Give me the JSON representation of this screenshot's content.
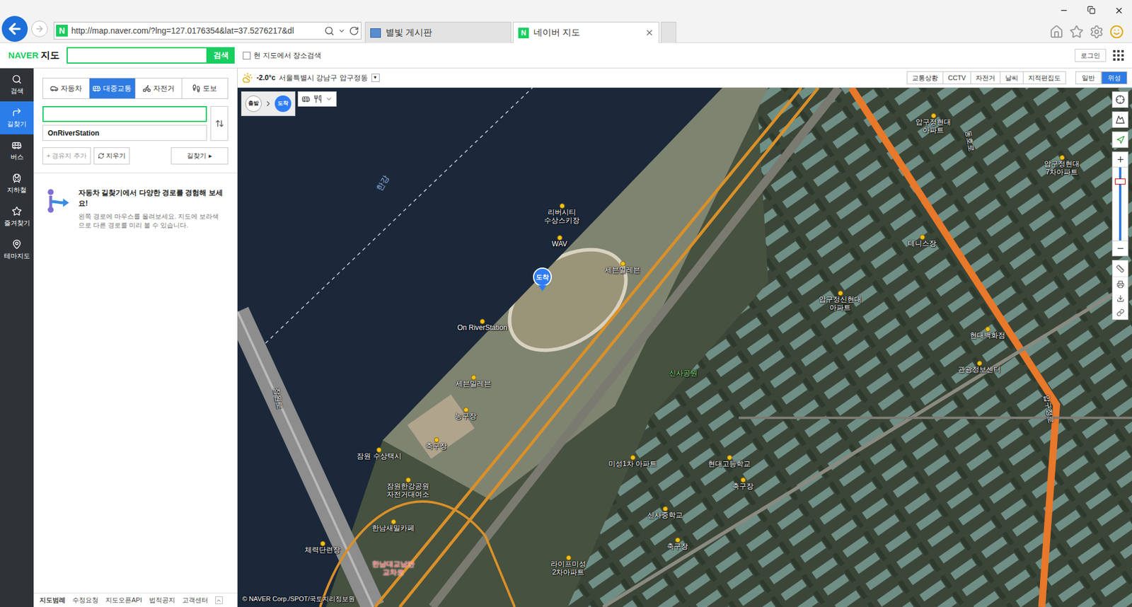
{
  "browser": {
    "url": "http://map.naver.com/?lng=127.0176354&lat=37.5276217&dl",
    "favicon": "N",
    "tabs": [
      {
        "label": "별빛 게시판",
        "selected": false
      },
      {
        "label": "네이버 지도",
        "selected": true
      }
    ]
  },
  "header": {
    "logo_brand": "NAVER",
    "logo_service": "지도",
    "search": {
      "value": "",
      "button": "검색"
    },
    "checkbox": {
      "label": "현 지도에서 장소검색",
      "checked": false
    },
    "login": "로그인"
  },
  "nav": [
    {
      "label": "검색",
      "selected": false
    },
    {
      "label": "길찾기",
      "selected": true
    },
    {
      "label": "버스",
      "selected": false
    },
    {
      "label": "지하철",
      "selected": false
    },
    {
      "label": "즐겨찾기",
      "selected": false
    },
    {
      "label": "테마지도",
      "selected": false
    }
  ],
  "panel": {
    "modes": [
      {
        "label": "자동차",
        "selected": false
      },
      {
        "label": "대중교통",
        "selected": true
      },
      {
        "label": "자전거",
        "selected": false
      },
      {
        "label": "도보",
        "selected": false
      }
    ],
    "origin": {
      "value": "",
      "focused": true
    },
    "destination": {
      "value": "OnRiverStation",
      "focused": false
    },
    "buttons": {
      "add": "+ 경유지 추가",
      "clear": "지우기",
      "search": "길찾기 ▸"
    },
    "tip": {
      "title": "자동차 길찾기에서 다양한 경로를 경험해 보세요!",
      "body": "왼쪽 경로에 마우스를 올려보세요. 지도에 보라색으로 다른 경로를 미리 볼 수 있습니다."
    },
    "footer": [
      "지도범례",
      "수정요청",
      "지도오픈API",
      "법적공지",
      "고객센터"
    ]
  },
  "map": {
    "weather": {
      "temp": "-2.0°c",
      "location": "서울특별시 강남구 압구정동",
      "dropdown": "▾"
    },
    "layers": [
      {
        "label": "교통상황",
        "selected": false
      },
      {
        "label": "CCTV",
        "selected": false
      },
      {
        "label": "자전거",
        "selected": false
      },
      {
        "label": "날씨",
        "selected": false
      },
      {
        "label": "지적편집도",
        "selected": false
      }
    ],
    "views": [
      {
        "label": "일반",
        "selected": false
      },
      {
        "label": "위성",
        "selected": true
      }
    ],
    "route_steps": [
      "출발",
      "도착"
    ],
    "zoom": {
      "level": 0.83
    },
    "destination_pin": "도착",
    "labels": [
      {
        "text": "한강",
        "kind": "water"
      },
      {
        "text": "리버시티 수상스키장",
        "kind": "poi"
      },
      {
        "text": "WAV",
        "kind": "poi"
      },
      {
        "text": "세븐일레븐",
        "kind": "poi"
      },
      {
        "text": "On RiverStation",
        "kind": "poi"
      },
      {
        "text": "세븐일레븐",
        "kind": "poi"
      },
      {
        "text": "농구장",
        "kind": "poi"
      },
      {
        "text": "축구장",
        "kind": "poi"
      },
      {
        "text": "잠원 수상택시",
        "kind": "poi"
      },
      {
        "text": "잠원한강공원 자전거대여소",
        "kind": "poi"
      },
      {
        "text": "한남새밀카페",
        "kind": "poi"
      },
      {
        "text": "체력단련장",
        "kind": "poi"
      },
      {
        "text": "한남대교남단 교차로",
        "kind": "junction"
      },
      {
        "text": "신사공원",
        "kind": "park"
      },
      {
        "text": "압구정신현대 아파트",
        "kind": "poi"
      },
      {
        "text": "미성1차 아파트",
        "kind": "poi"
      },
      {
        "text": "현대고등학교",
        "kind": "poi"
      },
      {
        "text": "축구장",
        "kind": "poi"
      },
      {
        "text": "신사중학교",
        "kind": "poi"
      },
      {
        "text": "축구장",
        "kind": "poi"
      },
      {
        "text": "라이프미성 2차아파트",
        "kind": "poi"
      },
      {
        "text": "테니스장",
        "kind": "poi"
      },
      {
        "text": "압구정현대 아파트",
        "kind": "poi"
      },
      {
        "text": "동호로",
        "kind": "road"
      },
      {
        "text": "압구정현대 7차아파트",
        "kind": "poi"
      },
      {
        "text": "현대백화점",
        "kind": "poi"
      },
      {
        "text": "관광정보센터",
        "kind": "poi"
      },
      {
        "text": "잠원로",
        "kind": "road"
      },
      {
        "text": "압구정로",
        "kind": "road"
      }
    ],
    "copyright": "© NAVER Corp./SPOT/국토지리정보원"
  }
}
